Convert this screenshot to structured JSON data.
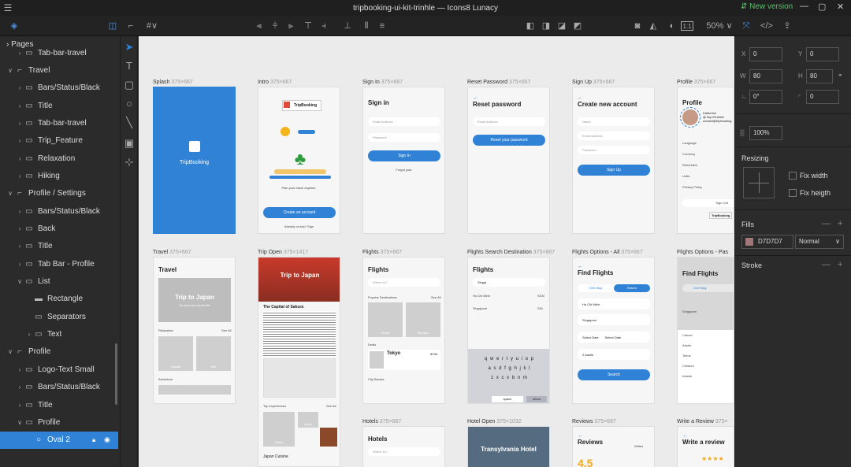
{
  "window": {
    "title": "tripbooking-ui-kit-trinhle — Icons8 Lunacy",
    "new_version": "New version",
    "min": "—",
    "max": "▢",
    "close": "✕"
  },
  "toolbar": {
    "zoom": "50%",
    "zoom_chevron": "∨",
    "aspect": "1:1"
  },
  "left": {
    "pages_label": "Pages",
    "layers": [
      {
        "label": "Tab-bar-travel",
        "indent": 1,
        "caret": "›",
        "icon": "folder",
        "selected": false
      },
      {
        "label": "Travel",
        "indent": 0,
        "caret": "∨",
        "icon": "artboard",
        "selected": false
      },
      {
        "label": "Bars/Status/Black",
        "indent": 1,
        "caret": "›",
        "icon": "folder",
        "selected": false
      },
      {
        "label": "Title",
        "indent": 1,
        "caret": "›",
        "icon": "folder",
        "selected": false
      },
      {
        "label": "Tab-bar-travel",
        "indent": 1,
        "caret": "›",
        "icon": "folder",
        "selected": false
      },
      {
        "label": "Trip_Feature",
        "indent": 1,
        "caret": "›",
        "icon": "folder",
        "selected": false
      },
      {
        "label": "Relaxation",
        "indent": 1,
        "caret": "›",
        "icon": "folder",
        "selected": false
      },
      {
        "label": "Hiking",
        "indent": 1,
        "caret": "›",
        "icon": "folder",
        "selected": false
      },
      {
        "label": "Profile / Settings",
        "indent": 0,
        "caret": "∨",
        "icon": "artboard",
        "selected": false
      },
      {
        "label": "Bars/Status/Black",
        "indent": 1,
        "caret": "›",
        "icon": "folder",
        "selected": false
      },
      {
        "label": "Back",
        "indent": 1,
        "caret": "›",
        "icon": "folder",
        "selected": false
      },
      {
        "label": "Title",
        "indent": 1,
        "caret": "›",
        "icon": "folder",
        "selected": false
      },
      {
        "label": "Tab Bar - Profile",
        "indent": 1,
        "caret": "›",
        "icon": "folder",
        "selected": false
      },
      {
        "label": "List",
        "indent": 1,
        "caret": "∨",
        "icon": "folder",
        "selected": false
      },
      {
        "label": "Rectangle",
        "indent": 2,
        "caret": "",
        "icon": "rect",
        "selected": false
      },
      {
        "label": "Separators",
        "indent": 2,
        "caret": "",
        "icon": "folder",
        "selected": false
      },
      {
        "label": "Text",
        "indent": 2,
        "caret": "›",
        "icon": "folder",
        "selected": false
      },
      {
        "label": "Profile",
        "indent": 0,
        "caret": "∨",
        "icon": "artboard",
        "selected": false
      },
      {
        "label": "Logo-Text Small",
        "indent": 1,
        "caret": "›",
        "icon": "folder",
        "selected": false
      },
      {
        "label": "Bars/Status/Black",
        "indent": 1,
        "caret": "›",
        "icon": "folder",
        "selected": false
      },
      {
        "label": "Title",
        "indent": 1,
        "caret": "›",
        "icon": "folder",
        "selected": false
      },
      {
        "label": "Profile",
        "indent": 1,
        "caret": "∨",
        "icon": "folder",
        "selected": false
      },
      {
        "label": "Oval 2",
        "indent": 2,
        "caret": "",
        "icon": "oval",
        "selected": true
      }
    ]
  },
  "artboards": {
    "row1": [
      {
        "name": "Splash",
        "size": "375×667"
      },
      {
        "name": "Intro",
        "size": "375×667"
      },
      {
        "name": "Sign In",
        "size": "375×667"
      },
      {
        "name": "Reset Password",
        "size": "375×667"
      },
      {
        "name": "Sign Up",
        "size": "375×667"
      },
      {
        "name": "Profile",
        "size": "375×667"
      }
    ],
    "row2": [
      {
        "name": "Travel",
        "size": "375×667"
      },
      {
        "name": "Trip Open",
        "size": "375×1417"
      },
      {
        "name": "Flights",
        "size": "375×667"
      },
      {
        "name": "Flights Search Destination",
        "size": "375×667"
      },
      {
        "name": "Flights Options - All",
        "size": "375×667"
      },
      {
        "name": "Flights Options - Pas",
        "size": ""
      }
    ],
    "row3": [
      {
        "name": "Hotels",
        "size": "375×667"
      },
      {
        "name": "Hotel Open",
        "size": "375×1032"
      },
      {
        "name": "Reviews",
        "size": "375×667"
      },
      {
        "name": "Write a Review",
        "size": "375×"
      }
    ]
  },
  "screens": {
    "splash": {
      "brand": "TripBooking"
    },
    "intro": {
      "brand": "TripBooking",
      "tagline": "Plan your travel anytime.",
      "cta": "Create an account",
      "link": "Already on trip? Sign"
    },
    "signin": {
      "title": "Sign in",
      "email": "Email Address",
      "password": "Password",
      "cta": "Sign In",
      "forgot": "Forgot your"
    },
    "reset": {
      "title": "Reset password",
      "email": "Email Address",
      "cta": "Reset your password"
    },
    "signup": {
      "title": "Create new account",
      "name": "Name",
      "email": "Email Address",
      "password": "Password",
      "cta": "Sign Up"
    },
    "profile": {
      "title": "Profile",
      "name": "Katherine",
      "handle": "@ fay.Christine",
      "email": "contact@tripbooking",
      "rows": [
        "Language",
        "Currency",
        "Reminders",
        "Units",
        "Privacy Policy"
      ],
      "signout": "Sign Out",
      "brand": "TripBooking"
    },
    "travel": {
      "title": "Travel",
      "hero": "Trip to Japan",
      "hero_sub": "the journey of your life",
      "relaxation": "Relaxation",
      "see_all": "See All",
      "hawaii": "Hawaii",
      "bali": "Bali",
      "adventure": "Adventure"
    },
    "tripopen": {
      "hero": "Trip to Japan",
      "capital": "The Capital of Sakura",
      "top": "Top experiences",
      "see_all": "See All",
      "tokyo_tile": "Tokyo",
      "kyoto": "Kyoto",
      "cuisine": "Japan Cuisine"
    },
    "flights": {
      "title": "Flights",
      "where": "Where to?",
      "popular": "Popular Destinations",
      "see_all": "See All",
      "rome": "Rome",
      "monaco": "Monaco",
      "deals": "Deals",
      "tokyo": "Tokyo",
      "price": "$736",
      "city_breaks": "City Breaks"
    },
    "search": {
      "title": "Flights",
      "query": "Singa|",
      "r1": "Ho Chi Minh",
      "r1code": "SGN",
      "r2": "Singapore",
      "r2code": "SIN",
      "keys1": "q w e r t y u i o p",
      "keys2": "a s d f g h j k l",
      "keys3": "z x c v b n m",
      "space": "space",
      "ret": "return"
    },
    "options": {
      "title": "Find Flights",
      "oneway": "One Way",
      "return": "Return",
      "from": "Ho Chi Minh",
      "to": "Singapore",
      "depart": "Select Date",
      "ret": "Select Date",
      "pax": "2 Adults",
      "cta": "Search"
    },
    "options2": {
      "title": "Find Flights",
      "oneway": "One Way",
      "to": "Singapore",
      "cancel": "Cancel",
      "adults": "Adults",
      "teens": "Teens",
      "children": "Children",
      "infants": "Infants"
    },
    "hotels": {
      "title": "Hotels",
      "where": "Where to?"
    },
    "hotelopen": {
      "hero": "Transylvania Hotel"
    },
    "reviews": {
      "title": "Reviews",
      "writes": "Writes",
      "rating": "4.5"
    },
    "write": {
      "title": "Write a review",
      "stars": "★★★★"
    }
  },
  "right": {
    "x": "0",
    "y": "0",
    "w": "80",
    "h": "80",
    "rot": "0°",
    "radius": "0",
    "opacity": "100%",
    "resizing": "Resizing",
    "fix_width": "Fix width",
    "fix_height": "Fix heigth",
    "fills": "Fills",
    "fill_hex": "D7D7D7",
    "blend": "Normal",
    "stroke": "Stroke",
    "lbl_x": "X",
    "lbl_y": "Y",
    "lbl_w": "W",
    "lbl_h": "H"
  },
  "colors": {
    "accent": "#2f82d6",
    "panel": "#2b2b2b",
    "canvas": "#ebebeb",
    "green": "#59c36a"
  }
}
